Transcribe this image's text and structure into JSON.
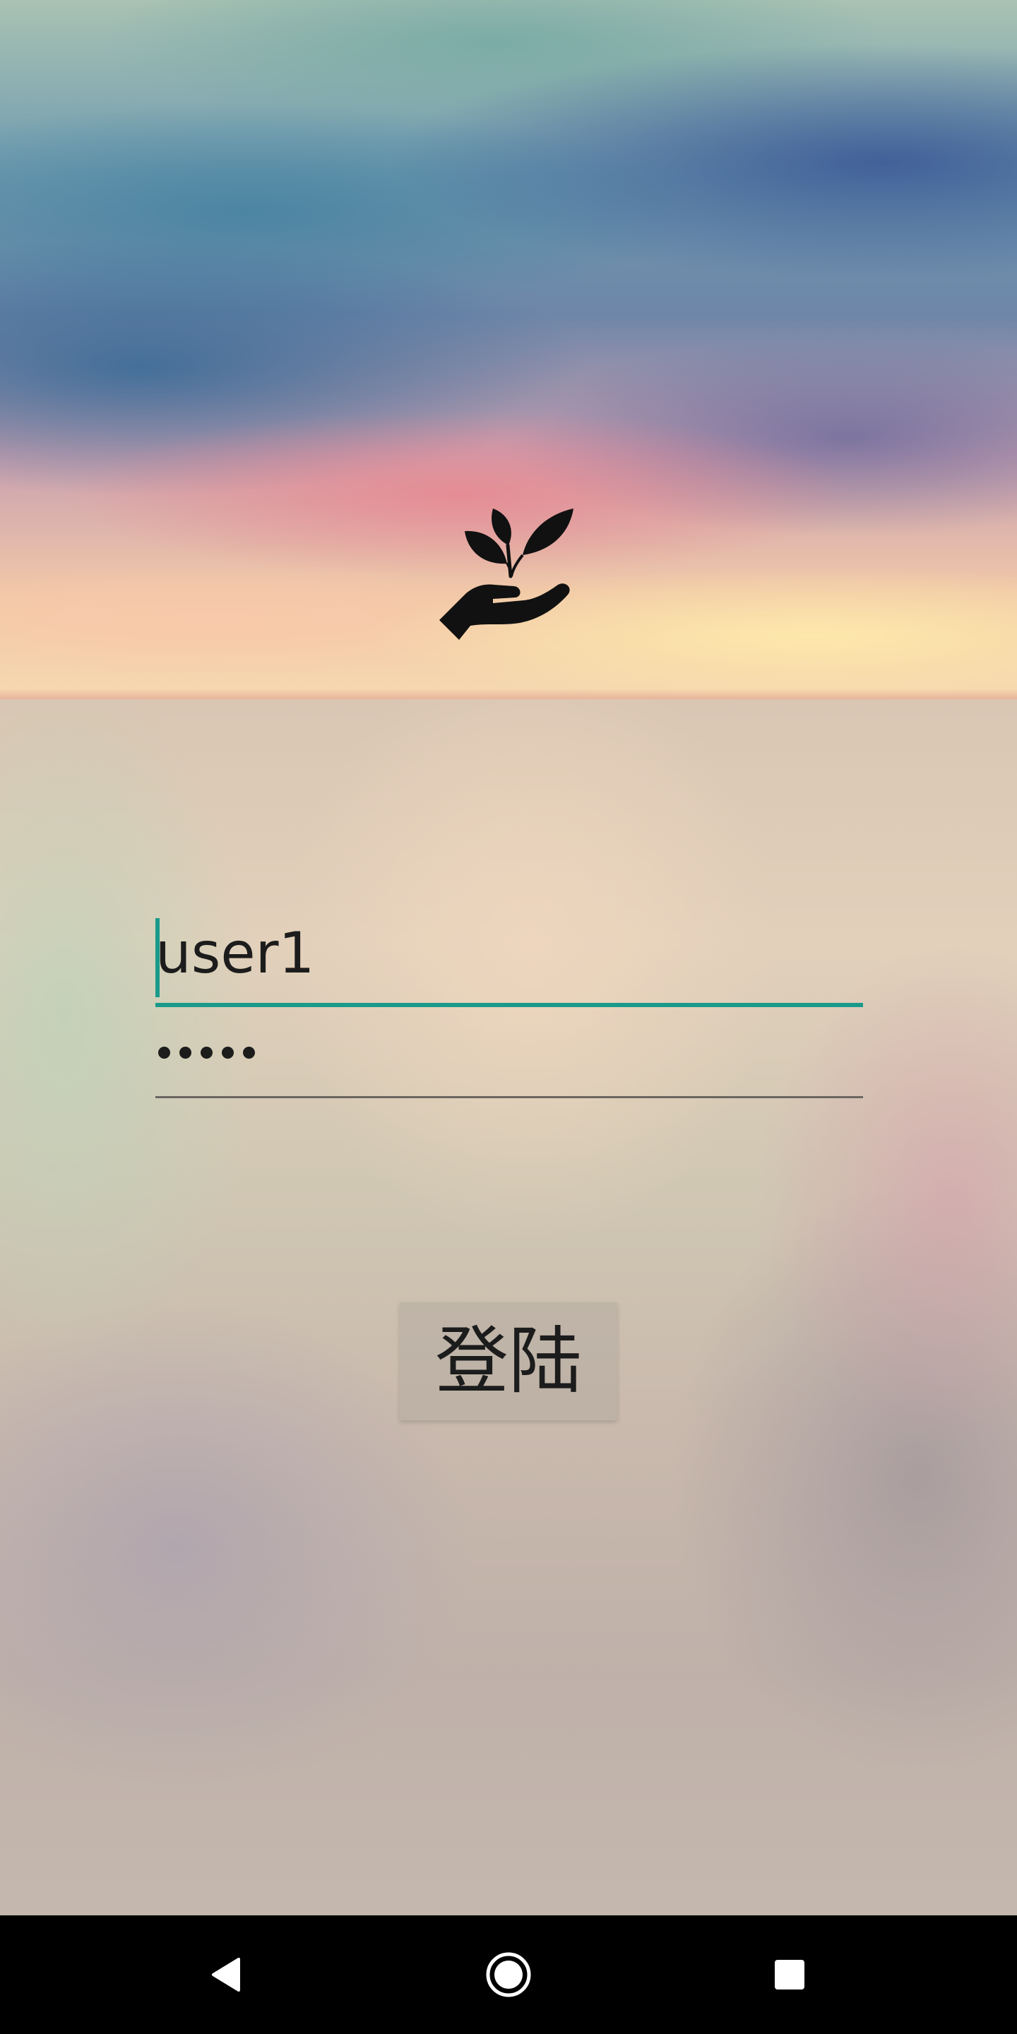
{
  "login_form": {
    "username_value": "user1",
    "password_mask_length": 5,
    "login_button_label": "登陆"
  },
  "colors": {
    "accent": "#1a9a8a",
    "text": "#1c1c1c",
    "navbar": "#000000"
  },
  "icons": {
    "logo": "hand-holding-plant-icon",
    "back": "back-triangle-icon",
    "home": "home-circle-icon",
    "recents": "recents-square-icon"
  }
}
